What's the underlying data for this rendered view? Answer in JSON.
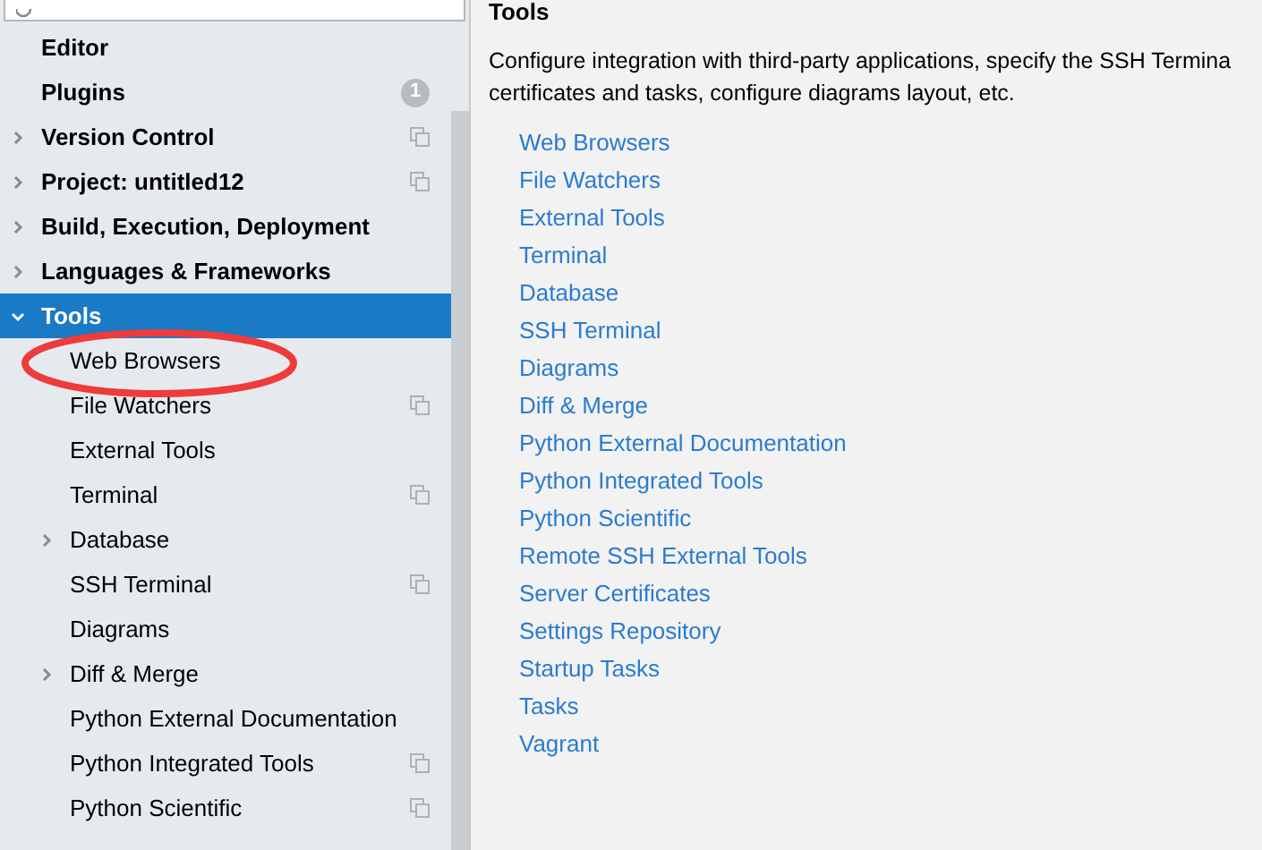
{
  "sidebar": {
    "items": [
      {
        "label": "Editor",
        "selected": false
      },
      {
        "label": "Plugins",
        "selected": false,
        "badge": "1"
      },
      {
        "label": "Version Control",
        "selected": false,
        "expanded": false,
        "project_level": true
      },
      {
        "label": "Project: untitled12",
        "selected": false,
        "expanded": false,
        "project_level": true
      },
      {
        "label": "Build, Execution, Deployment",
        "selected": false,
        "expanded": false
      },
      {
        "label": "Languages & Frameworks",
        "selected": false,
        "expanded": false
      },
      {
        "label": "Tools",
        "selected": true,
        "expanded": true,
        "children": [
          {
            "label": "Web Browsers",
            "selected": false
          },
          {
            "label": "File Watchers",
            "selected": false,
            "project_level": true
          },
          {
            "label": "External Tools",
            "selected": false
          },
          {
            "label": "Terminal",
            "selected": false,
            "project_level": true
          },
          {
            "label": "Database",
            "selected": false,
            "expanded": false
          },
          {
            "label": "SSH Terminal",
            "selected": false,
            "project_level": true
          },
          {
            "label": "Diagrams",
            "selected": false
          },
          {
            "label": "Diff & Merge",
            "selected": false,
            "expanded": false
          },
          {
            "label": "Python External Documentation",
            "selected": false
          },
          {
            "label": "Python Integrated Tools",
            "selected": false,
            "project_level": true
          },
          {
            "label": "Python Scientific",
            "selected": false,
            "project_level": true
          }
        ]
      }
    ]
  },
  "content": {
    "title": "Tools",
    "description_lines": [
      "Configure integration with third-party applications, specify the SSH Termina",
      "certificates and tasks, configure diagrams layout, etc."
    ],
    "links": [
      "Web Browsers",
      "File Watchers",
      "External Tools",
      "Terminal",
      "Database",
      "SSH Terminal",
      "Diagrams",
      "Diff & Merge",
      "Python External Documentation",
      "Python Integrated Tools",
      "Python Scientific",
      "Remote SSH External Tools",
      "Server Certificates",
      "Settings Repository",
      "Startup Tasks",
      "Tasks",
      "Vagrant"
    ]
  }
}
